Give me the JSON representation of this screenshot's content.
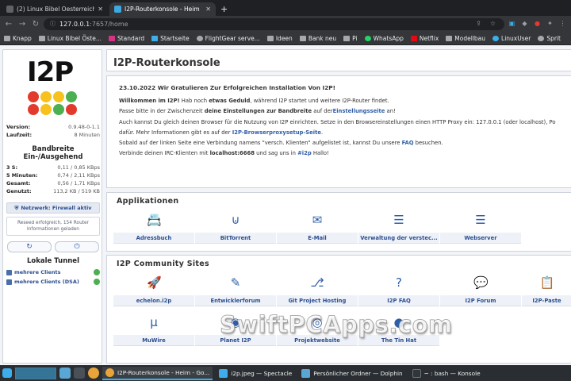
{
  "browser": {
    "tabs": [
      {
        "title": "(2) Linux Bibel Oesterreich -",
        "active": false
      },
      {
        "title": "I2P-Routerkonsole - Heim",
        "active": true
      }
    ],
    "new_tab": "+",
    "url_host": "127.0.0.1",
    "url_path": ":7657/home",
    "bookmarks": [
      "Knapp",
      "Linux Bibel Öste...",
      "Standard",
      "Startseite",
      "FlightGear serve...",
      "Ideen",
      "Bank neu",
      "Pi",
      "WhatsApp",
      "Netflix",
      "Modellbau",
      "LinuxUser",
      "Sprit"
    ]
  },
  "sidebar": {
    "logo_text": "I2P",
    "dot_colors": [
      "#e23b2e",
      "#f7c21e",
      "#f7c21e",
      "#4caf50",
      "#e23b2e",
      "#f7c21e",
      "#4caf50",
      "#e23b2e"
    ],
    "version_label": "Version:",
    "version": "0.9.48-0-1.1",
    "uptime_label": "Laufzeit:",
    "uptime": "8 Minuten",
    "bandwidth_title_1": "Bandbreite",
    "bandwidth_title_2": "Ein-/Ausgehend",
    "bandwidth": [
      {
        "label": "3 S:",
        "value": "0,11 / 0,85 KBps"
      },
      {
        "label": "5 Minuten:",
        "value": "0,74 / 2,11 KBps"
      },
      {
        "label": "Gesamt:",
        "value": "0,56 / 1,71 KBps"
      },
      {
        "label": "Genutzt:",
        "value": "113,2 KB / 519 KB"
      }
    ],
    "network_status": "Netzwerk: Firewall aktiv",
    "reseed_1": "Reseed erfolgreich, 154 Router",
    "reseed_2": "Informationen geladen",
    "restart_icon": "↻",
    "shutdown_icon": "⏻",
    "tunnels_title": "Lokale Tunnel",
    "tunnels": [
      "mehrere Clients",
      "mehrere Clients (DSA)"
    ]
  },
  "main": {
    "title": "I2P-Routerkonsole",
    "news": {
      "date": "23.10.2022 Wir Gratulieren Zur Erfolgreichen Installation Von I2P!",
      "l1a": "Willkommen im I2P!",
      "l1b": " Hab noch ",
      "l1c": "etwas Geduld",
      "l1d": ", während I2P startet und weitere I2P-Router findet.",
      "l2a": "Passe bitte in der Zwischenzeit ",
      "l2b": "deine Einstellungen zur Bandbreite",
      "l2c": " auf der",
      "l2d": "Einstellungsseite",
      "l2e": " an!",
      "l3": "Auch kannst Du gleich deinen Browser für die Nutzung von I2P einrichten. Setze in den Browsereinstellungen einen HTTP Proxy ein: 127.0.0.1 (oder localhost), Po",
      "l4a": "dafür. Mehr Informationen gibt es auf der ",
      "l4b": "I2P-Browserproxysetup-Seite",
      "l4c": ".",
      "l5a": "Sobald auf der linken Seite eine Verbindung namens \"versch. Klienten\" aufgelistet ist, kannst Du unsere ",
      "l5b": "FAQ",
      "l5c": " besuchen.",
      "l6a": "Verbinde deinen IRC-Klienten mit ",
      "l6b": "localhost:6668",
      "l6c": " und sag uns in ",
      "l6d": "#i2p",
      "l6e": " Hallo!"
    },
    "apps_title": "Applikationen",
    "apps": [
      {
        "label": "Adressbuch",
        "icon": "📇"
      },
      {
        "label": "BitTorrent",
        "icon": "⊍"
      },
      {
        "label": "E-Mail",
        "icon": "✉"
      },
      {
        "label": "Verwaltung der verstec...",
        "icon": "☰"
      },
      {
        "label": "Webserver",
        "icon": "☰"
      }
    ],
    "community_title": "I2P Community Sites",
    "community": [
      {
        "label": "echelon.i2p",
        "icon": "🚀"
      },
      {
        "label": "Entwicklerforum",
        "icon": "✎"
      },
      {
        "label": "Git Project Hosting",
        "icon": "⎇"
      },
      {
        "label": "I2P FAQ",
        "icon": "?"
      },
      {
        "label": "I2P Forum",
        "icon": "💬"
      },
      {
        "label": "I2P-Paste",
        "icon": "📋"
      },
      {
        "label": "MuWire",
        "icon": "µ"
      },
      {
        "label": "Planet I2P",
        "icon": "◉"
      },
      {
        "label": "Projektwebsite",
        "icon": "◎"
      },
      {
        "label": "The Tin Hat",
        "icon": "●"
      }
    ]
  },
  "watermark": "SwiftPCApps.com",
  "taskbar": {
    "tasks": [
      {
        "label": "I2P-Routerkonsole - Heim - Go...",
        "color": "#e8a33a",
        "active": true
      },
      {
        "label": "i2p.jpeg — Spectacle",
        "color": "#3daee9",
        "active": false
      },
      {
        "label": "Persönlicher Ordner — Dolphin",
        "color": "#5aa7d6",
        "active": false
      },
      {
        "label": "~ : bash — Konsole",
        "color": "#31363b",
        "active": false
      }
    ]
  }
}
